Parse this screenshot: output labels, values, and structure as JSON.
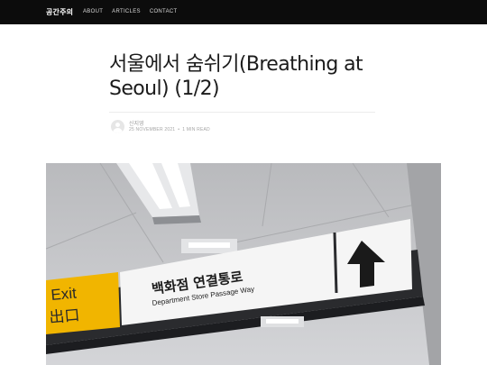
{
  "header": {
    "brand": "공간주의",
    "nav": [
      {
        "label": "ABOUT"
      },
      {
        "label": "ARTICLES"
      },
      {
        "label": "CONTACT"
      }
    ]
  },
  "article": {
    "title": "서울에서 숨쉬기(Breathing at Seoul) (1/2)",
    "author": "신지영",
    "date": "25 NOVEMBER 2021",
    "separator": "•",
    "read_time": "1 MIN READ"
  },
  "hero_sign": {
    "exit_label": "Exit",
    "exit_label_korean": "出口",
    "main_label_korean": "백화점 연결통로",
    "main_label_english": "Department Store Passage Way",
    "arrow_icon": "up-arrow-icon",
    "colors": {
      "exit_panel": "#f1b500",
      "sign_panel": "#f5f5f5",
      "sign_frame": "#2a2b2e"
    }
  }
}
